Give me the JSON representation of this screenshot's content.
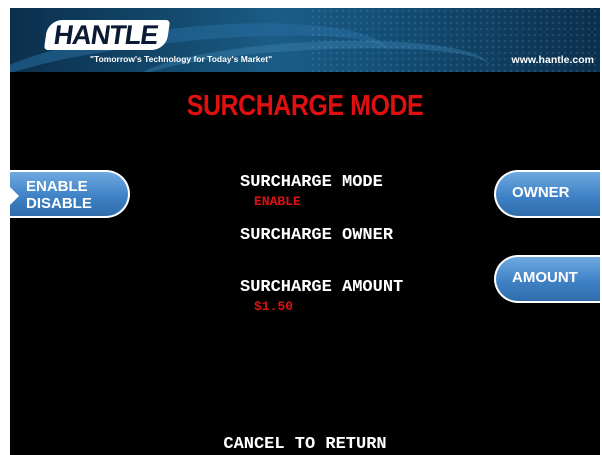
{
  "header": {
    "logo_text": "HANTLE",
    "slogan": "\"Tomorrow's Technology for Today's Market\"",
    "website": "www.hantle.com"
  },
  "title": "SURCHARGE MODE",
  "left_button": {
    "line1": "ENABLE",
    "line2": "DISABLE"
  },
  "right_buttons": {
    "owner": "OWNER",
    "amount": "AMOUNT"
  },
  "settings": [
    {
      "label": "SURCHARGE MODE",
      "value": "ENABLE"
    },
    {
      "label": "SURCHARGE OWNER",
      "value": ""
    },
    {
      "label": "SURCHARGE AMOUNT",
      "value": "$1.50"
    }
  ],
  "footer": "CANCEL TO RETURN",
  "colors": {
    "title_red": "#e01010",
    "button_blue": "#3f82c6",
    "background": "#000000"
  }
}
